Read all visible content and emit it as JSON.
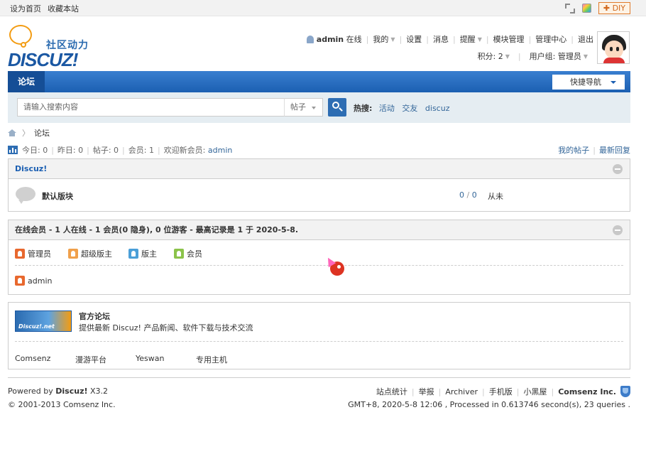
{
  "topbar": {
    "set_home": "设为首页",
    "bookmark": "收藏本站",
    "diy_label": "DIY"
  },
  "logo": {
    "cn_text": "社区动力",
    "en_text": "DISCUZ!"
  },
  "usernav": {
    "username": "admin",
    "online": "在线",
    "my": "我的",
    "settings": "设置",
    "messages": "消息",
    "reminders": "提醒",
    "block_manage": "模块管理",
    "admin_center": "管理中心",
    "logout": "退出"
  },
  "userinfo": {
    "credits": "积分: 2",
    "usergroup": "用户组: 管理员"
  },
  "navbar": {
    "tab_forum": "论坛",
    "quick_nav": "快捷导航"
  },
  "search": {
    "placeholder": "请输入搜索内容",
    "type": "帖子",
    "hot_label": "热搜:",
    "hot_terms": [
      "活动",
      "交友",
      "discuz"
    ]
  },
  "breadcrumb": {
    "current": "论坛"
  },
  "stats": {
    "today": "今日: 0",
    "yesterday": "昨日: 0",
    "posts": "帖子: 0",
    "members": "会员: 1",
    "welcome": "欢迎新会员:",
    "new_member": "admin",
    "my_posts": "我的帖子",
    "latest_replies": "最新回复"
  },
  "category": {
    "title": "Discuz!",
    "forums": [
      {
        "name": "默认版块",
        "threads": "0",
        "posts": "0",
        "last_post": "从未"
      }
    ]
  },
  "online": {
    "title": "在线会员 - 1 人在线 - 1 会员(0 隐身), 0 位游客 - 最高记录是 1 于 2020-5-8.",
    "legend": [
      {
        "label": "管理员",
        "color": "#e8682e"
      },
      {
        "label": "超级版主",
        "color": "#f0a04b"
      },
      {
        "label": "版主",
        "color": "#4a9fd8"
      },
      {
        "label": "会员",
        "color": "#8bc34a"
      }
    ],
    "users": [
      {
        "name": "admin",
        "color": "#e8682e"
      }
    ]
  },
  "links": {
    "official_logo_text": "Discuz!.net",
    "official_title": "官方论坛",
    "official_desc": "提供最新 Discuz! 产品新闻、软件下载与技术交流",
    "items": [
      "Comsenz",
      "漫游平台",
      "Yeswan",
      "专用主机"
    ]
  },
  "footer": {
    "powered_prefix": "Powered by",
    "powered_name": "Discuz!",
    "version": "X3.2",
    "copyright": "© 2001-2013 Comsenz Inc.",
    "links": [
      "站点统计",
      "举报",
      "Archiver",
      "手机版",
      "小黑屋"
    ],
    "company": "Comsenz Inc.",
    "process_info": "GMT+8, 2020-5-8 12:06 , Processed in 0.613746 second(s), 23 queries ."
  },
  "colors": {
    "brand_blue": "#1b5fb2",
    "link": "#336699",
    "logo_orange": "#f39c12"
  }
}
